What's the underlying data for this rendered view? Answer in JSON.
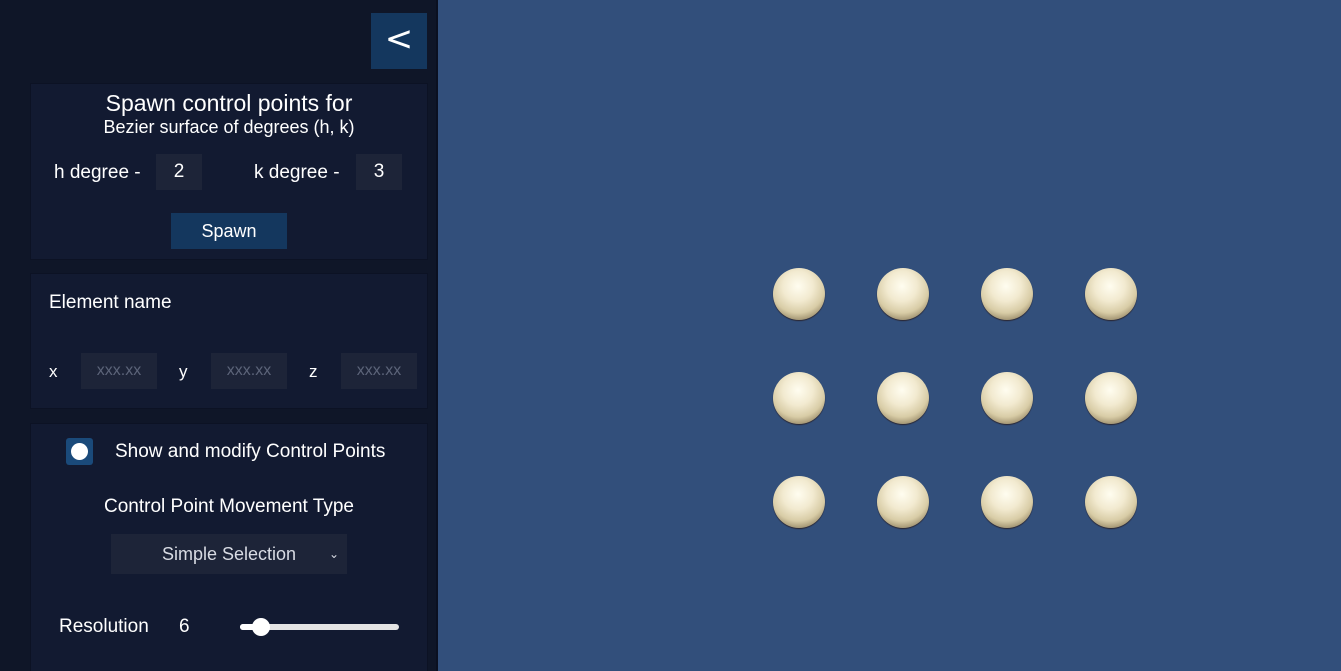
{
  "panel": {
    "collapse_label": "<",
    "spawn": {
      "title": "Spawn control points for",
      "subtitle": "Bezier surface of degrees (h, k)",
      "h_label": "h degree -",
      "h_value": "2",
      "k_label": "k degree -",
      "k_value": "3",
      "button_label": "Spawn"
    },
    "element": {
      "name_label": "Element name",
      "x_label": "x",
      "y_label": "y",
      "z_label": "z",
      "x_placeholder": "xxx.xx",
      "y_placeholder": "xxx.xx",
      "z_placeholder": "xxx.xx"
    },
    "control_points": {
      "toggle_label": "Show and modify Control Points",
      "toggle_on": true,
      "movement_label": "Control Point Movement Type",
      "movement_selected": "Simple Selection",
      "resolution_label": "Resolution",
      "resolution_value": "6",
      "resolution_fraction": 0.13
    }
  },
  "viewport": {
    "grid_rows": 3,
    "grid_cols": 4
  },
  "colors": {
    "panel_bg": "#0f1628",
    "section_bg": "#121a31",
    "accent": "#14375e",
    "viewport_bg": "#324f7b",
    "sphere": "#f2ead0"
  }
}
